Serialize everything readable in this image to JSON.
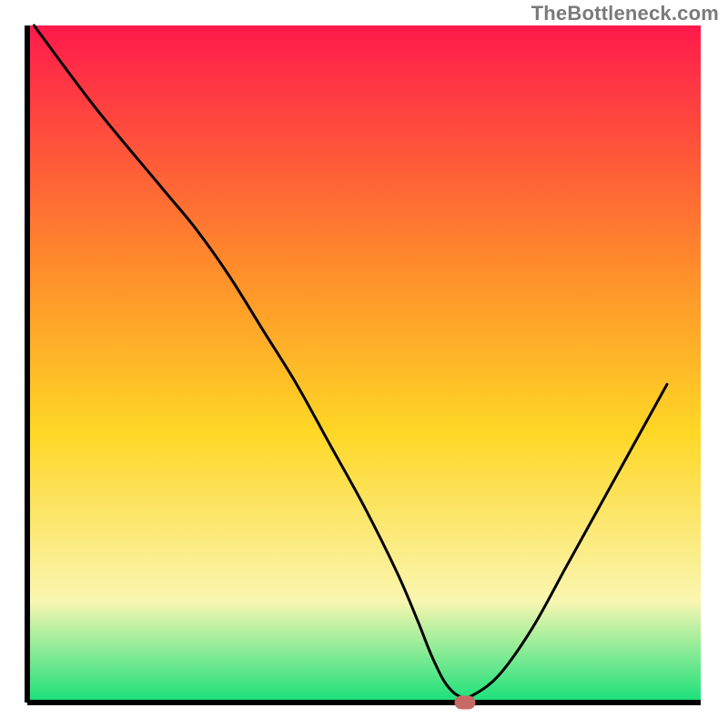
{
  "watermark": "TheBottleneck.com",
  "colors": {
    "axis": "#000000",
    "curve": "#000000",
    "marker_fill": "#c76a65",
    "marker_stroke": "#c76a65",
    "grad_top": "#ff1a4b",
    "grad_upper": "#ff8a2b",
    "grad_mid": "#ffd725",
    "grad_lower": "#f9f6b0",
    "grad_bottom": "#18e07a",
    "background": "#ffffff"
  },
  "chart_data": {
    "type": "line",
    "axes": {
      "xrange": [
        0,
        100
      ],
      "yrange": [
        0,
        100
      ],
      "ticks_visible": false,
      "grid": false
    },
    "title": "",
    "xlabel": "",
    "ylabel": "",
    "series": [
      {
        "name": "bottleneck-curve",
        "x": [
          1,
          10,
          20,
          25,
          30,
          35,
          40,
          45,
          50,
          55,
          58,
          60,
          62,
          64,
          66,
          70,
          75,
          80,
          85,
          90,
          95
        ],
        "y": [
          100,
          88,
          76,
          70,
          63,
          55,
          47,
          38,
          29,
          19,
          12,
          7,
          3,
          1,
          1,
          4,
          11,
          20,
          29,
          38,
          47
        ]
      }
    ],
    "marker": {
      "x": 65,
      "y": 0,
      "shape": "rounded-rect"
    },
    "legend": null,
    "annotations": []
  }
}
